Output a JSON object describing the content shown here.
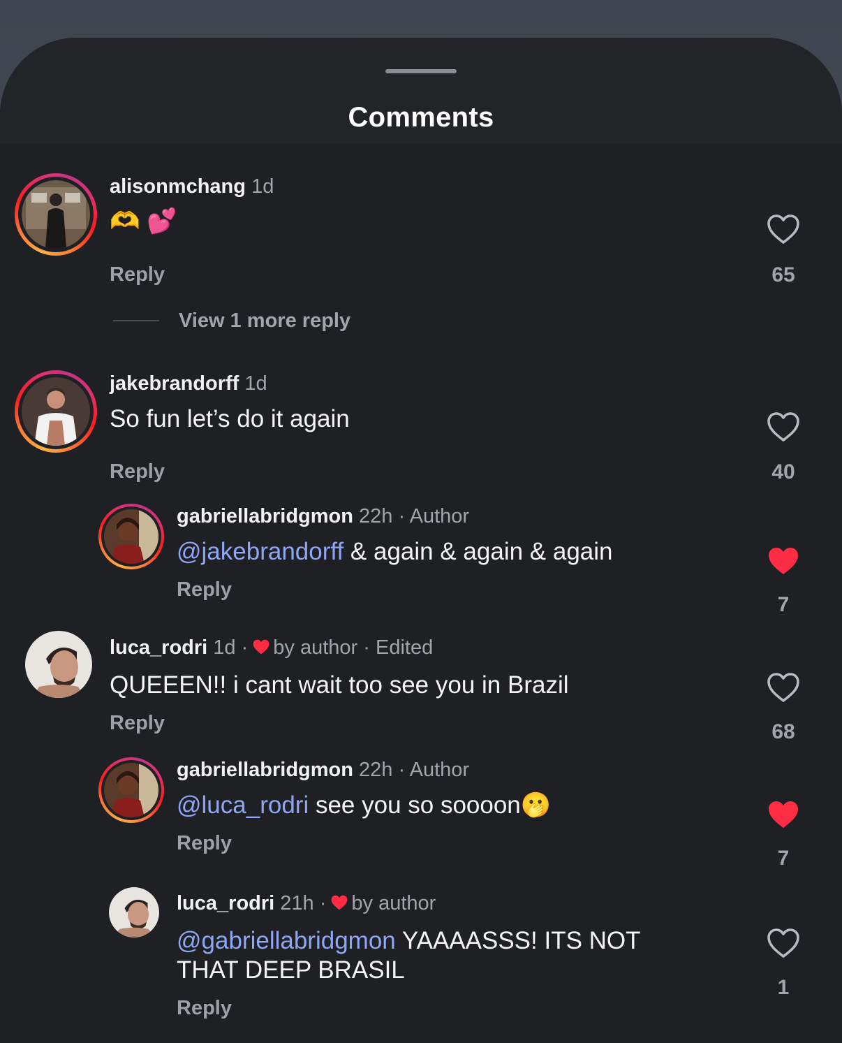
{
  "header": {
    "title": "Comments"
  },
  "comments": [
    {
      "username": "alisonmchang",
      "time": "1d",
      "text": "🫶 💕",
      "reply_label": "Reply",
      "likes": "65",
      "liked": false,
      "view_more": "View 1 more reply"
    },
    {
      "username": "jakebrandorff",
      "time": "1d",
      "text": "So fun let’s do it again",
      "reply_label": "Reply",
      "likes": "40",
      "liked": false
    },
    {
      "username": "gabriellabridgmon",
      "time": "22h",
      "author_tag": "· Author",
      "mention": "@jakebrandorff",
      "text": " & again & again & again",
      "reply_label": "Reply",
      "likes": "7",
      "liked": true
    },
    {
      "username": "luca_rodri",
      "time": "1d",
      "sep1": "·",
      "liked_by": "by author",
      "edited": "· Edited",
      "text": "QUEEEN!! i cant wait too see you in Brazil",
      "reply_label": "Reply",
      "likes": "68",
      "liked": false
    },
    {
      "username": "gabriellabridgmon",
      "time": "22h",
      "author_tag": "· Author",
      "mention": "@luca_rodri",
      "text": " see you so soooon🫢",
      "reply_label": "Reply",
      "likes": "7",
      "liked": true
    },
    {
      "username": "luca_rodri",
      "time": "21h",
      "sep1": "·",
      "liked_by": "by author",
      "mention": "@gabriellabridgmon",
      "text": " YAAAASSS! ITS NOT",
      "text_line2": "THAT DEEP BRASIL",
      "reply_label": "Reply",
      "likes": "1",
      "liked": false
    }
  ],
  "colors": {
    "background": "#1e2024",
    "mention": "#8ea6f5",
    "like_red": "#ff2d44",
    "muted": "#a3a5aa"
  }
}
